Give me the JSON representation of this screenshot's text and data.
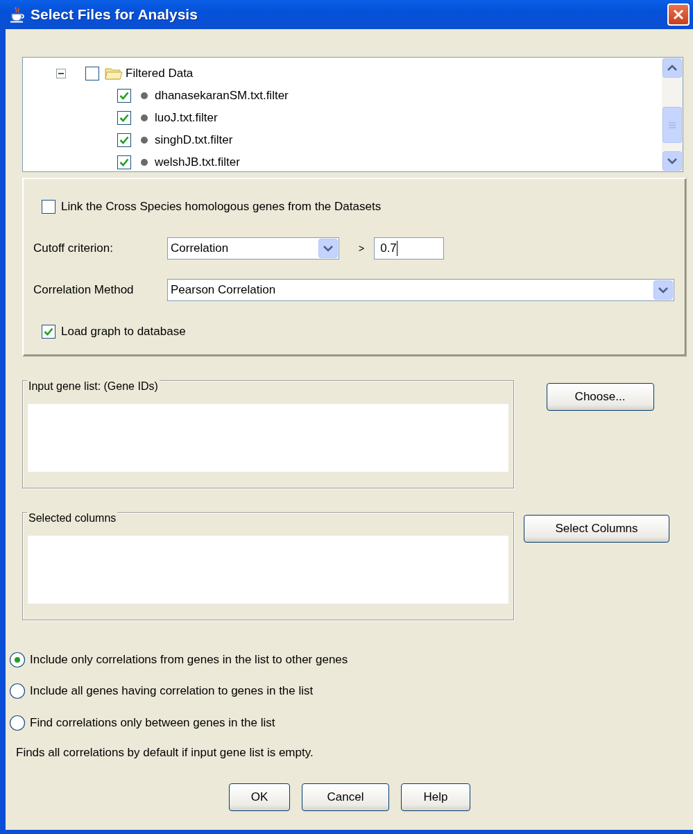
{
  "window": {
    "title": "Select Files for Analysis"
  },
  "tree": {
    "items": [
      {
        "label": "Filtered Data",
        "kind": "folder",
        "checked": false,
        "expanded": true,
        "children": [
          {
            "label": "dhanasekaranSM.txt.filter",
            "kind": "file",
            "checked": true
          },
          {
            "label": "luoJ.txt.filter",
            "kind": "file",
            "checked": true
          },
          {
            "label": "singhD.txt.filter",
            "kind": "file",
            "checked": true
          },
          {
            "label": "welshJB.txt.filter",
            "kind": "file",
            "checked": true
          }
        ]
      }
    ]
  },
  "options": {
    "link_species": {
      "label": "Link the Cross Species homologous genes from the Datasets",
      "checked": false
    },
    "cutoff": {
      "label": "Cutoff criterion:",
      "value": "Correlation",
      "operator": ">",
      "threshold": "0.7"
    },
    "method": {
      "label": "Correlation Method",
      "value": "Pearson Correlation"
    },
    "load_graph": {
      "label": "Load graph to database",
      "checked": true
    }
  },
  "input_gene_list": {
    "title": "Input gene list: (Gene IDs)",
    "button": "Choose..."
  },
  "selected_columns": {
    "title": "Selected columns",
    "button": "Select Columns"
  },
  "modes": [
    {
      "label": "Include only correlations from genes in the list to other genes",
      "selected": true
    },
    {
      "label": "Include all genes having correlation to genes in the list",
      "selected": false
    },
    {
      "label": "Find correlations only between genes in the list",
      "selected": false
    }
  ],
  "note": "Finds all correlations by default if input gene list is empty.",
  "buttons": [
    "OK",
    "Cancel",
    "Help"
  ]
}
